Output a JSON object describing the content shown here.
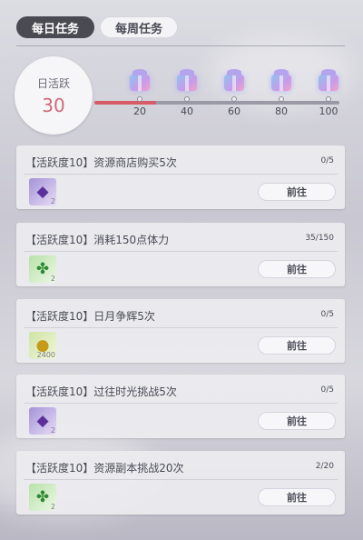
{
  "tabs": {
    "daily": "每日任务",
    "weekly": "每周任务"
  },
  "activity": {
    "label": "日活跃",
    "value": "30",
    "progress_fraction": 0.25
  },
  "milestones": [
    {
      "label": "20"
    },
    {
      "label": "40"
    },
    {
      "label": "60"
    },
    {
      "label": "80"
    },
    {
      "label": "100"
    }
  ],
  "tasks": [
    {
      "title": "【活跃度10】资源商店购买5次",
      "progress": "0/5",
      "reward_icon": "crystal-icon",
      "reward_glyph": "◆",
      "reward_count": "2",
      "button": "前往"
    },
    {
      "title": "【活跃度10】消耗150点体力",
      "progress": "35/150",
      "reward_icon": "clover-icon",
      "reward_glyph": "✤",
      "reward_count": "2",
      "button": "前往"
    },
    {
      "title": "【活跃度10】日月争辉5次",
      "progress": "0/5",
      "reward_icon": "coin-icon",
      "reward_glyph": "●",
      "reward_count": "2400",
      "button": "前往"
    },
    {
      "title": "【活跃度10】过往时光挑战5次",
      "progress": "0/5",
      "reward_icon": "crystal-icon",
      "reward_glyph": "◆",
      "reward_count": "2",
      "button": "前往"
    },
    {
      "title": "【活跃度10】资源副本挑战20次",
      "progress": "2/20",
      "reward_icon": "clover-icon",
      "reward_glyph": "✤",
      "reward_count": "2",
      "button": "前往"
    }
  ],
  "colors": {
    "accent": "#d65a68",
    "tab_active": "#4a4a52"
  }
}
